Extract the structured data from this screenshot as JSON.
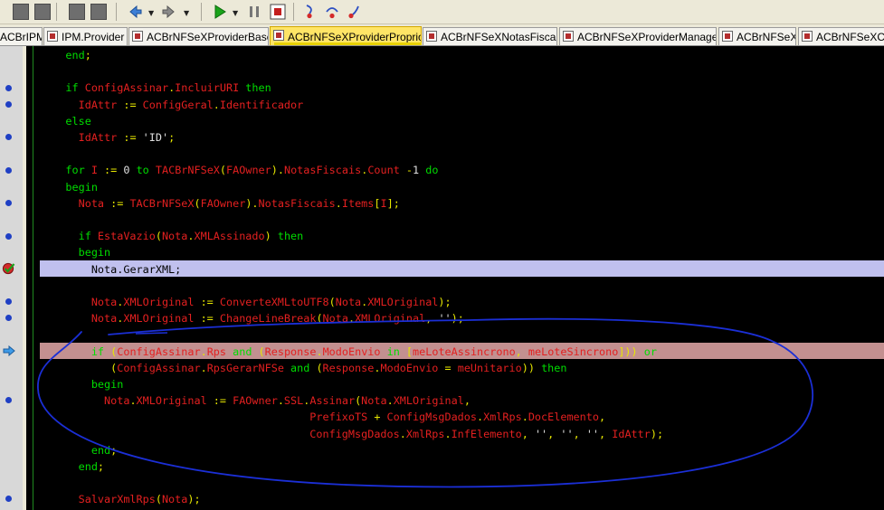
{
  "tabs": [
    {
      "label": "ACBrIPM",
      "active": false
    },
    {
      "label": "IPM.Provider",
      "active": false
    },
    {
      "label": "ACBrNFSeXProviderBase",
      "active": false
    },
    {
      "label": "ACBrNFSeXProviderProprio",
      "active": true
    },
    {
      "label": "ACBrNFSeXNotasFiscais",
      "active": false
    },
    {
      "label": "ACBrNFSeXProviderManager",
      "active": false
    },
    {
      "label": "ACBrNFSeX",
      "active": false
    },
    {
      "label": "ACBrNFSeXCo",
      "active": false
    }
  ],
  "toolbar": {
    "icons": [
      "save-icon",
      "save-all-icon",
      "open-icon",
      "toggle-form-icon",
      "back-icon",
      "forward-icon",
      "run-icon",
      "pause-icon",
      "stop-icon",
      "trace-into-icon",
      "step-over-icon",
      "run-until-return-icon"
    ]
  },
  "colors": {
    "keyword": "#00dd00",
    "identifier": "#e32020",
    "symbol": "#e8e800",
    "literal": "#e0e0e0",
    "execution_line": "#c0c0ee",
    "breakpoint_line": "#c39090",
    "annotation_ink": "#1b2fd6",
    "active_tab": "#ffe566"
  },
  "code": [
    [
      [
        "kw",
        "    end"
      ],
      [
        "op",
        ";"
      ]
    ],
    [],
    [
      [
        "kw",
        "    if "
      ],
      [
        "id",
        "ConfigAssinar"
      ],
      [
        "op",
        "."
      ],
      [
        "id",
        "IncluirURI"
      ],
      [
        "kw",
        " then"
      ]
    ],
    [
      [
        "id",
        "      IdAttr "
      ],
      [
        "op",
        ":= "
      ],
      [
        "id",
        "ConfigGeral"
      ],
      [
        "op",
        "."
      ],
      [
        "id",
        "Identificador"
      ]
    ],
    [
      [
        "kw",
        "    else"
      ]
    ],
    [
      [
        "id",
        "      IdAttr "
      ],
      [
        "op",
        ":= "
      ],
      [
        "str",
        "'ID'"
      ],
      [
        "op",
        ";"
      ]
    ],
    [],
    [
      [
        "kw",
        "    for "
      ],
      [
        "id",
        "I "
      ],
      [
        "op",
        ":= "
      ],
      [
        "num",
        "0"
      ],
      [
        "kw",
        " to "
      ],
      [
        "id",
        "TACBrNFSeX"
      ],
      [
        "op",
        "("
      ],
      [
        "id",
        "FAOwner"
      ],
      [
        "op",
        ")."
      ],
      [
        "id",
        "NotasFiscais"
      ],
      [
        "op",
        "."
      ],
      [
        "id",
        "Count"
      ],
      [
        "op",
        " -"
      ],
      [
        "num",
        "1"
      ],
      [
        "kw",
        " do"
      ]
    ],
    [
      [
        "kw",
        "    begin"
      ]
    ],
    [
      [
        "id",
        "      Nota "
      ],
      [
        "op",
        ":= "
      ],
      [
        "id",
        "TACBrNFSeX"
      ],
      [
        "op",
        "("
      ],
      [
        "id",
        "FAOwner"
      ],
      [
        "op",
        ")."
      ],
      [
        "id",
        "NotasFiscais"
      ],
      [
        "op",
        "."
      ],
      [
        "id",
        "Items"
      ],
      [
        "op",
        "["
      ],
      [
        "id",
        "I"
      ],
      [
        "op",
        "];"
      ]
    ],
    [],
    [
      [
        "kw",
        "      if "
      ],
      [
        "id",
        "EstaVazio"
      ],
      [
        "op",
        "("
      ],
      [
        "id",
        "Nota"
      ],
      [
        "op",
        "."
      ],
      [
        "id",
        "XMLAssinado"
      ],
      [
        "op",
        ")"
      ],
      [
        "kw",
        " then"
      ]
    ],
    [
      [
        "kw",
        "      begin"
      ]
    ],
    [
      [
        "id",
        "        Nota"
      ],
      [
        "op",
        "."
      ],
      [
        "id",
        "GerarXML"
      ],
      [
        "op",
        ";"
      ]
    ],
    [],
    [
      [
        "id",
        "        Nota"
      ],
      [
        "op",
        "."
      ],
      [
        "id",
        "XMLOriginal "
      ],
      [
        "op",
        ":= "
      ],
      [
        "id",
        "ConverteXMLtoUTF8"
      ],
      [
        "op",
        "("
      ],
      [
        "id",
        "Nota"
      ],
      [
        "op",
        "."
      ],
      [
        "id",
        "XMLOriginal"
      ],
      [
        "op",
        ");"
      ]
    ],
    [
      [
        "id",
        "        Nota"
      ],
      [
        "op",
        "."
      ],
      [
        "id",
        "XMLOriginal "
      ],
      [
        "op",
        ":= "
      ],
      [
        "id",
        "ChangeLineBreak"
      ],
      [
        "op",
        "("
      ],
      [
        "id",
        "Nota"
      ],
      [
        "op",
        "."
      ],
      [
        "id",
        "XMLOriginal"
      ],
      [
        "op",
        ", "
      ],
      [
        "str",
        "''"
      ],
      [
        "op",
        ");"
      ]
    ],
    [],
    [
      [
        "kw",
        "        if "
      ],
      [
        "op",
        "("
      ],
      [
        "id",
        "ConfigAssinar"
      ],
      [
        "op",
        "."
      ],
      [
        "id",
        "Rps"
      ],
      [
        "kw",
        " and "
      ],
      [
        "op",
        "("
      ],
      [
        "id",
        "Response"
      ],
      [
        "op",
        "."
      ],
      [
        "id",
        "ModoEnvio"
      ],
      [
        "kw",
        " in "
      ],
      [
        "op",
        "["
      ],
      [
        "id",
        "meLoteAssincrono"
      ],
      [
        "op",
        ", "
      ],
      [
        "id",
        "meLoteSincrono"
      ],
      [
        "op",
        "]))"
      ],
      [
        "kw",
        " or"
      ]
    ],
    [
      [
        "op",
        "           ("
      ],
      [
        "id",
        "ConfigAssinar"
      ],
      [
        "op",
        "."
      ],
      [
        "id",
        "RpsGerarNFSe"
      ],
      [
        "kw",
        " and "
      ],
      [
        "op",
        "("
      ],
      [
        "id",
        "Response"
      ],
      [
        "op",
        "."
      ],
      [
        "id",
        "ModoEnvio"
      ],
      [
        "op",
        " = "
      ],
      [
        "id",
        "meUnitario"
      ],
      [
        "op",
        "))"
      ],
      [
        "kw",
        " then"
      ]
    ],
    [
      [
        "kw",
        "        begin"
      ]
    ],
    [
      [
        "id",
        "          Nota"
      ],
      [
        "op",
        "."
      ],
      [
        "id",
        "XMLOriginal "
      ],
      [
        "op",
        ":= "
      ],
      [
        "id",
        "FAOwner"
      ],
      [
        "op",
        "."
      ],
      [
        "id",
        "SSL"
      ],
      [
        "op",
        "."
      ],
      [
        "id",
        "Assinar"
      ],
      [
        "op",
        "("
      ],
      [
        "id",
        "Nota"
      ],
      [
        "op",
        "."
      ],
      [
        "id",
        "XMLOriginal"
      ],
      [
        "op",
        ","
      ]
    ],
    [
      [
        "id",
        "                                          PrefixoTS "
      ],
      [
        "op",
        "+ "
      ],
      [
        "id",
        "ConfigMsgDados"
      ],
      [
        "op",
        "."
      ],
      [
        "id",
        "XmlRps"
      ],
      [
        "op",
        "."
      ],
      [
        "id",
        "DocElemento"
      ],
      [
        "op",
        ","
      ]
    ],
    [
      [
        "id",
        "                                          ConfigMsgDados"
      ],
      [
        "op",
        "."
      ],
      [
        "id",
        "XmlRps"
      ],
      [
        "op",
        "."
      ],
      [
        "id",
        "InfElemento"
      ],
      [
        "op",
        ", "
      ],
      [
        "str",
        "''"
      ],
      [
        "op",
        ", "
      ],
      [
        "str",
        "''"
      ],
      [
        "op",
        ", "
      ],
      [
        "str",
        "''"
      ],
      [
        "op",
        ", "
      ],
      [
        "id",
        "IdAttr"
      ],
      [
        "op",
        ");"
      ]
    ],
    [
      [
        "kw",
        "        end"
      ],
      [
        "op",
        ";"
      ]
    ],
    [
      [
        "kw",
        "      end"
      ],
      [
        "op",
        ";"
      ]
    ],
    [],
    [
      [
        "id",
        "      SalvarXmlRps"
      ],
      [
        "op",
        "("
      ],
      [
        "id",
        "Nota"
      ],
      [
        "op",
        ");"
      ]
    ]
  ]
}
